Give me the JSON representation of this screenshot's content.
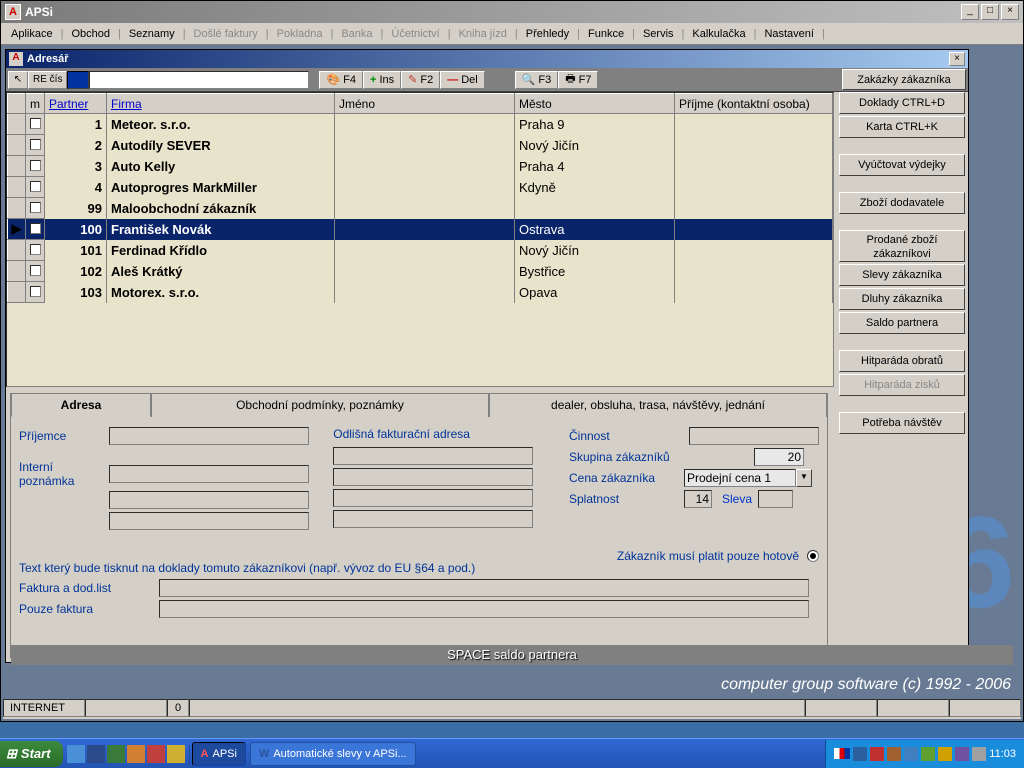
{
  "app": {
    "title": "APSi",
    "icon_letter": "A"
  },
  "win_buttons": {
    "min": "_",
    "max": "□",
    "close": "×"
  },
  "menu": {
    "items": [
      "Aplikace",
      "Obchod",
      "Seznamy",
      "Došlé faktury",
      "Pokladna",
      "Banka",
      "Účetnictví",
      "Kniha jízd",
      "Přehledy",
      "Funkce",
      "Servis",
      "Kalkulačka",
      "Nastavení"
    ],
    "disabled": [
      3,
      4,
      5,
      6,
      7
    ]
  },
  "child": {
    "title": "Adresář",
    "close": "×"
  },
  "toolbar": {
    "corner": "↖",
    "re": "RE čís",
    "f4": "F4",
    "ins": "Ins",
    "f2": "F2",
    "del": "Del",
    "f3": "F3",
    "f7": "F7",
    "ins_icon": "+",
    "del_icon": "—",
    "edit_icon": "✎",
    "search_icon": "🔍",
    "print_icon": "🖶",
    "color_icon": "🎨"
  },
  "grid": {
    "headers": {
      "m": "m",
      "partner": "Partner",
      "firma": "Firma",
      "jmeno": "Jméno",
      "mesto": "Město",
      "prijme": "Příjme (kontaktní osoba)"
    },
    "rows": [
      {
        "id": "1",
        "firma": "Meteor. s.r.o.",
        "mesto": "Praha 9"
      },
      {
        "id": "2",
        "firma": "Autodíly SEVER",
        "mesto": "Nový Jičín"
      },
      {
        "id": "3",
        "firma": "Auto Kelly",
        "mesto": "Praha 4"
      },
      {
        "id": "4",
        "firma": "Autoprogres MarkMiller",
        "mesto": "Kdyně"
      },
      {
        "id": "99",
        "firma": "Maloobchodní zákazník",
        "mesto": ""
      },
      {
        "id": "100",
        "firma": "František Novák",
        "mesto": "Ostrava",
        "selected": true
      },
      {
        "id": "101",
        "firma": "Ferdinad Křídlo",
        "mesto": "Nový Jičín"
      },
      {
        "id": "102",
        "firma": "Aleš Krátký",
        "mesto": "Bystřice"
      },
      {
        "id": "103",
        "firma": "Motorex. s.r.o.",
        "mesto": "Opava"
      }
    ]
  },
  "tabs": {
    "t1": "Adresa",
    "t2": "Obchodní podmínky, poznámky",
    "t3": "dealer, obsluha, trasa, návštěvy, jednání"
  },
  "form": {
    "prijemce": "Příjemce",
    "interni": "Interní poznámka",
    "odlisna": "Odlišná fakturační adresa",
    "cinnost": "Činnost",
    "skupina": "Skupina zákazníků",
    "skupina_val": "20",
    "cena": "Cena zákazníka",
    "cena_val": "Prodejní cena 1",
    "splatnost": "Splatnost",
    "splatnost_val": "14",
    "sleva": "Sleva",
    "hotove": "Zákazník musí platit pouze hotově",
    "tisk_text": "Text který bude tisknut na doklady tomuto zákazníkovi (např. vývoz do EU §64 a pod.)",
    "faktura_dod": "Faktura a dod.list",
    "pouze_faktura": "Pouze faktura"
  },
  "sidebtns": {
    "zakazky": "Zakázky zákazníka",
    "doklady": "Doklady CTRL+D",
    "karta": "Karta    CTRL+K",
    "vyuctovat": "Vyúčtovat výdejky",
    "zbozi_dod": "Zboží dodavatele",
    "prodane": "Prodané zboží zákazníkovi",
    "slevy": "Slevy zákazníka",
    "dluhy": "Dluhy zákazníka",
    "saldo": "Saldo partnera",
    "hit_obratu": "Hitparáda obratů",
    "hit_zisku": "Hitparáda zisků",
    "potreba": "Potřeba návštěv"
  },
  "footer": {
    "space": "SPACE saldo partnera",
    "brand": "computer group software    (c) 1992 - 2006",
    "status1": "INTERNET",
    "status2": "0",
    "bignum": "6"
  },
  "taskbar": {
    "start": "Start",
    "app": "APSi",
    "doc": "Automatické slevy v APSi...",
    "time": "11:03"
  }
}
